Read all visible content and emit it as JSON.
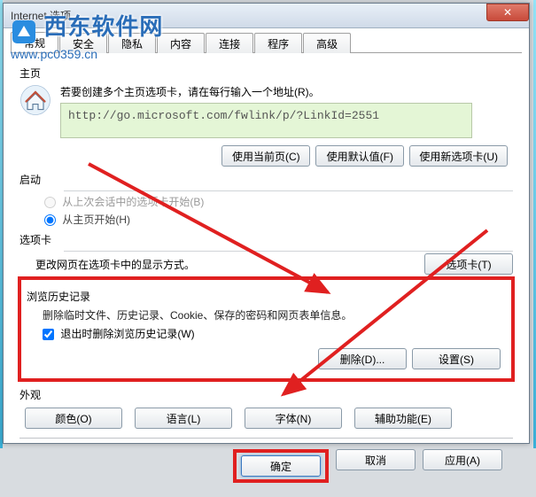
{
  "window": {
    "title": "Internet 选项",
    "close_glyph": "✕"
  },
  "watermark": {
    "brand": "西东软件网",
    "url": "www.pc0359.cn"
  },
  "tabs": {
    "general": "常规",
    "security": "安全",
    "privacy": "隐私",
    "content": "内容",
    "connections": "连接",
    "programs": "程序",
    "advanced": "高级"
  },
  "homepage": {
    "label": "主页",
    "hint": "若要创建多个主页选项卡，请在每行输入一个地址(R)。",
    "url": "http://go.microsoft.com/fwlink/p/?LinkId=2551",
    "btn_current": "使用当前页(C)",
    "btn_default": "使用默认值(F)",
    "btn_newtab": "使用新选项卡(U)"
  },
  "startup": {
    "label": "启动",
    "opt_last": "从上次会话中的选项卡开始(B)",
    "opt_home": "从主页开始(H)"
  },
  "tabs_section": {
    "label": "选项卡",
    "text": "更改网页在选项卡中的显示方式。",
    "btn": "选项卡(T)"
  },
  "history": {
    "label": "浏览历史记录",
    "text": "删除临时文件、历史记录、Cookie、保存的密码和网页表单信息。",
    "checkbox": "退出时删除浏览历史记录(W)",
    "btn_delete": "删除(D)...",
    "btn_settings": "设置(S)"
  },
  "appearance": {
    "label": "外观",
    "btn_color": "颜色(O)",
    "btn_lang": "语言(L)",
    "btn_font": "字体(N)",
    "btn_access": "辅助功能(E)"
  },
  "footer": {
    "ok": "确定",
    "cancel": "取消",
    "apply": "应用(A)"
  }
}
